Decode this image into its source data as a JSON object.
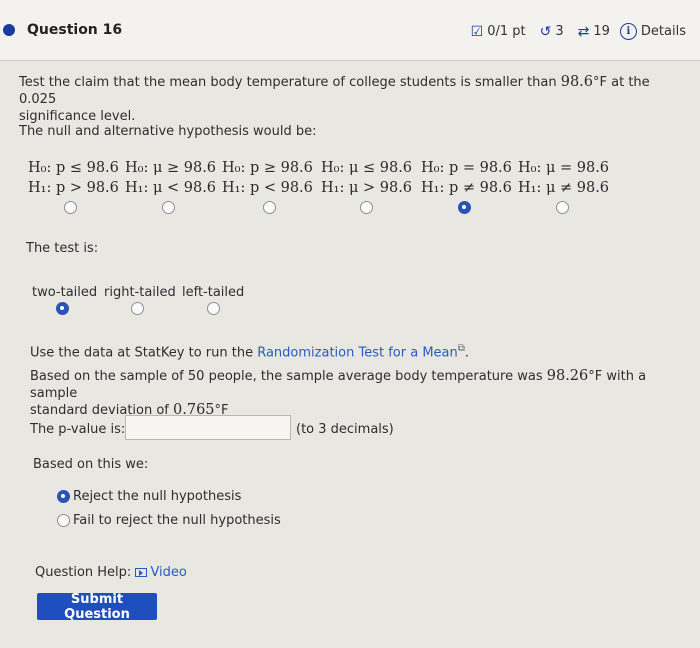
{
  "header": {
    "title": "Question 16",
    "score": "0/1 pt",
    "retries": "3",
    "attempts": "19",
    "details": "Details"
  },
  "prompt": {
    "line1_pre": "Test the claim that the mean body temperature of college students is smaller than ",
    "line1_value": "98.6",
    "line1_unit": "°F at the 0.025",
    "line2": "significance level.",
    "hypotheses_intro": "The null and alternative hypothesis would be:"
  },
  "hypotheses": [
    {
      "h0": "H₀: p ≤ 98.6",
      "h1": "H₁: p > 98.6",
      "selected": false
    },
    {
      "h0": "H₀: μ ≥ 98.6",
      "h1": "H₁: μ < 98.6",
      "selected": false
    },
    {
      "h0": "H₀: p ≥ 98.6",
      "h1": "H₁: p < 98.6",
      "selected": false
    },
    {
      "h0": "H₀: μ ≤ 98.6",
      "h1": "H₁: μ > 98.6",
      "selected": false
    },
    {
      "h0": "H₀: p = 98.6",
      "h1": "H₁: p ≠ 98.6",
      "selected": true
    },
    {
      "h0": "H₀: μ = 98.6",
      "h1": "H₁: μ ≠ 98.6",
      "selected": false
    }
  ],
  "test": {
    "label": "The test is:",
    "options": [
      {
        "label": "two-tailed",
        "selected": true
      },
      {
        "label": "right-tailed",
        "selected": false
      },
      {
        "label": "left-tailed",
        "selected": false
      }
    ]
  },
  "statkey": {
    "pre": "Use the data at StatKey to run the ",
    "link": "Randomization Test for a Mean",
    "post": "."
  },
  "sample": {
    "line1_pre": "Based on the sample of 50 people, the sample average body temperature was ",
    "mean": "98.26",
    "line1_post": "°F with a sample",
    "line2_pre": "standard deviation of ",
    "sd": "0.765",
    "line2_post": "°F"
  },
  "pvalue": {
    "label": "The p-value is:",
    "value": "",
    "hint": "(to 3 decimals)"
  },
  "conclusion": {
    "label": "Based on this we:",
    "options": [
      {
        "label": "Reject the null hypothesis",
        "selected": true
      },
      {
        "label": "Fail to reject the null hypothesis",
        "selected": false
      }
    ]
  },
  "help": {
    "label": "Question Help:",
    "video": "Video"
  },
  "submit_label": "Submit Question",
  "colors": {
    "accent": "#1f4fbf",
    "link": "#2a59c4",
    "background": "#e9e7e2"
  }
}
